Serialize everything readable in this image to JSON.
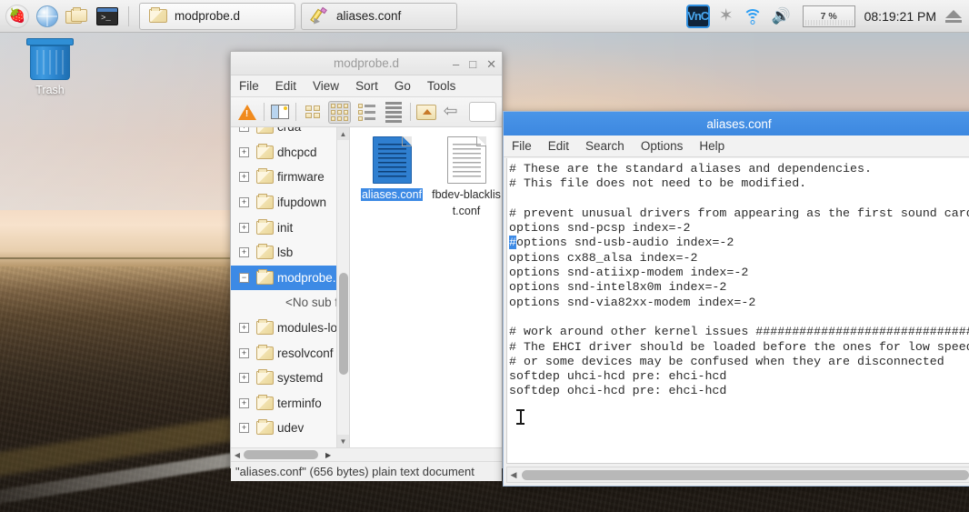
{
  "taskbar": {
    "launchers": [
      {
        "name": "raspberry-menu",
        "label": "🍓"
      },
      {
        "name": "web-browser",
        "label": "globe"
      },
      {
        "name": "file-manager",
        "label": "folders"
      },
      {
        "name": "terminal",
        "label": ">_"
      }
    ],
    "tasks": [
      {
        "label": "modprobe.d",
        "icon": "folder-icon"
      },
      {
        "label": "aliases.conf",
        "icon": "pencil-icon"
      }
    ],
    "tray": {
      "vnc_label": "VnC",
      "bluetooth_icon": "✶",
      "cpu_percent": "7 %",
      "clock": "08:19:21 PM"
    }
  },
  "desktop": {
    "icons": [
      {
        "label": "Trash",
        "icon": "trash-icon"
      }
    ]
  },
  "filemanager": {
    "title": "modprobe.d",
    "menus": [
      "File",
      "Edit",
      "View",
      "Sort",
      "Go",
      "Tools"
    ],
    "toolbar": [
      "warning-icon",
      "dual-pane-icon",
      "icon-view-icon",
      "thumbnail-view-icon",
      "compact-view-icon",
      "detailed-list-icon",
      "home-icon",
      "back-icon"
    ],
    "path_value": "",
    "tree": [
      {
        "label": "crda",
        "expander": "+",
        "selected": false
      },
      {
        "label": "dhcpcd",
        "expander": "+",
        "selected": false
      },
      {
        "label": "firmware",
        "expander": "+",
        "selected": false
      },
      {
        "label": "ifupdown",
        "expander": "+",
        "selected": false
      },
      {
        "label": "init",
        "expander": "+",
        "selected": false
      },
      {
        "label": "lsb",
        "expander": "+",
        "selected": false
      },
      {
        "label": "modprobe.d",
        "expander": "−",
        "selected": true
      },
      {
        "label": "<No sub folders>",
        "expander": "",
        "selected": false,
        "nosub": true
      },
      {
        "label": "modules-load.d",
        "expander": "+",
        "selected": false
      },
      {
        "label": "resolvconf",
        "expander": "+",
        "selected": false
      },
      {
        "label": "systemd",
        "expander": "+",
        "selected": false
      },
      {
        "label": "terminfo",
        "expander": "+",
        "selected": false
      },
      {
        "label": "udev",
        "expander": "+",
        "selected": false
      }
    ],
    "files": [
      {
        "label": "aliases.conf",
        "selected": true
      },
      {
        "label": "fbdev-blacklist.conf",
        "selected": false
      }
    ],
    "status": "\"aliases.conf\" (656 bytes) plain text document"
  },
  "editor": {
    "title": "aliases.conf",
    "menus": [
      "File",
      "Edit",
      "Search",
      "Options",
      "Help"
    ],
    "content_before_selection": "# These are the standard aliases and dependencies.\n# This file does not need to be modified.\n\n# prevent unusual drivers from appearing as the first sound card\noptions snd-pcsp index=-2\n",
    "selected_text": "#",
    "content_after_selection": "options snd-usb-audio index=-2\noptions cx88_alsa index=-2\noptions snd-atiixp-modem index=-2\noptions snd-intel8x0m index=-2\noptions snd-via82xx-modem index=-2\n\n# work around other kernel issues ##############################\n# The EHCI driver should be loaded before the ones for low speed\n# or some devices may be confused when they are disconnected\nsoftdep uhci-hcd pre: ehci-hcd\nsoftdep ohci-hcd pre: ehci-hcd\n"
  },
  "colors": {
    "accent_blue": "#3d8ae5",
    "titlebar_active": "#4a95e8",
    "selection_blue": "#3d8ae5",
    "taskbar_bg": "#ececec",
    "tray_blue": "#2a9df4"
  }
}
